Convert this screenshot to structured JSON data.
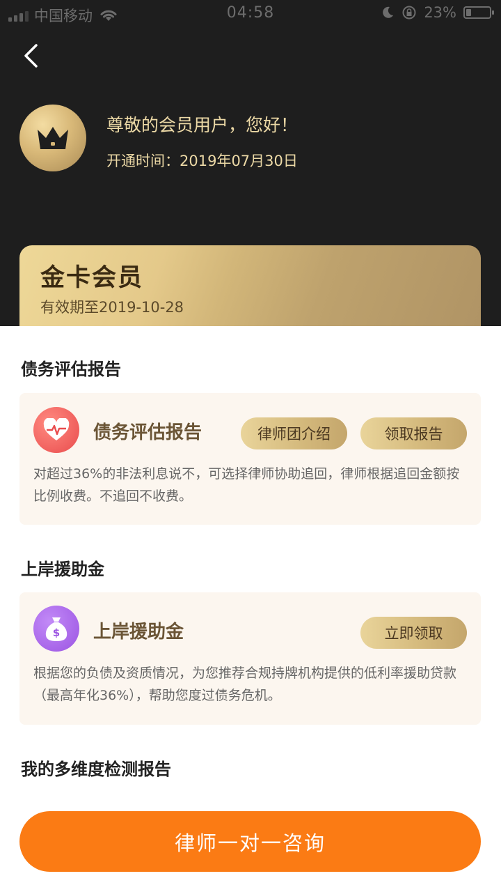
{
  "status_bar": {
    "carrier": "中国移动",
    "time": "04:58",
    "battery": "23%",
    "battery_level": 0.23
  },
  "header": {
    "greeting": "尊敬的会员用户，您好！",
    "open_time": "开通时间：2019年07月30日"
  },
  "member_card": {
    "title": "金卡会员",
    "validity": "有效期至2019-10-28"
  },
  "debt_section": {
    "title": "债务评估报告",
    "name": "债务评估报告",
    "lawyer_btn": "律师团介绍",
    "report_btn": "领取报告",
    "desc": "对超过36%的非法利息说不，可选择律师协助追回，律师根据追回金额按比例收费。不追回不收费。",
    "icon_color": "#f0595a"
  },
  "aid_section": {
    "title": "上岸援助金",
    "name": "上岸援助金",
    "claim_btn": "立即领取",
    "desc": "根据您的负债及资质情况，为您推荐合规持牌机构提供的低利率援助贷款（最高年化36%），帮助您度过债务危机。",
    "icon_color": "#a65fe8"
  },
  "report_section": {
    "title": "我的多维度检测报告"
  },
  "consult_button": "律师一对一咨询",
  "colors": {
    "accent": "#fb7b14",
    "gold": "#d8b878",
    "dark_bg": "#1e1e1e"
  }
}
